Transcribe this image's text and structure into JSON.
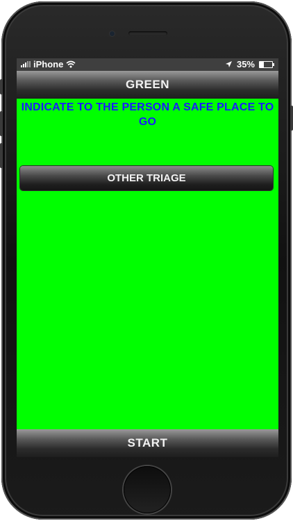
{
  "status_bar": {
    "carrier": "iPhone",
    "battery": "35%",
    "battery_level": 0.35,
    "icons": [
      "signal-icon",
      "wifi-icon",
      "location-arrow-icon",
      "battery-icon"
    ]
  },
  "nav": {
    "title": "GREEN"
  },
  "main": {
    "instruction": "INDICATE TO THE PERSON A SAFE PLACE TO GO",
    "other_triage_label": "OTHER TRIAGE"
  },
  "bottom": {
    "start_label": "START"
  },
  "colors": {
    "background": "#00ff00",
    "instruction_text": "#1a1aff",
    "bar": "#2c2c2c"
  }
}
